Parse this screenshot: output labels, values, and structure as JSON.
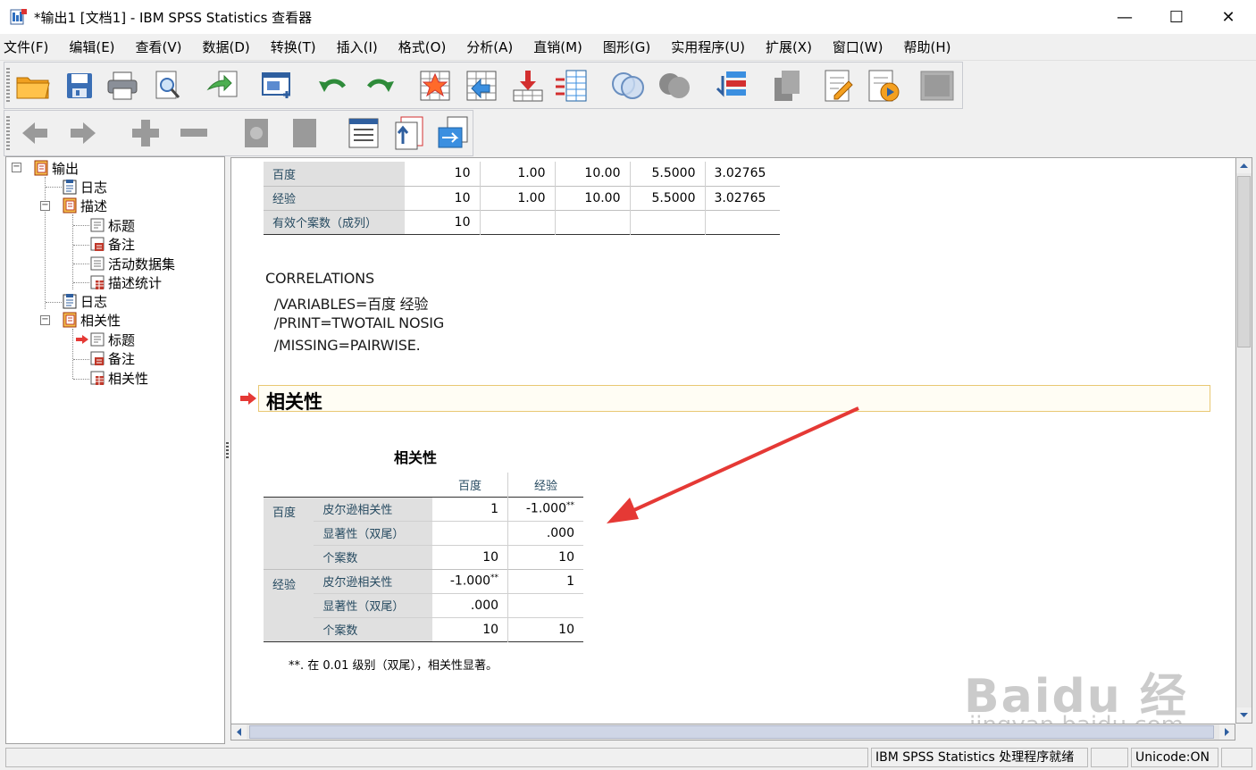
{
  "window": {
    "title": "*输出1 [文档1] - IBM SPSS Statistics 查看器",
    "minimize": "—",
    "maximize": "☐",
    "close": "✕"
  },
  "menu": [
    "文件(F)",
    "编辑(E)",
    "查看(V)",
    "数据(D)",
    "转换(T)",
    "插入(I)",
    "格式(O)",
    "分析(A)",
    "直销(M)",
    "图形(G)",
    "实用程序(U)",
    "扩展(X)",
    "窗口(W)",
    "帮助(H)"
  ],
  "toolbar1_icons": [
    "open-folder-icon",
    "save-icon",
    "print-icon",
    "print-preview-icon",
    "export-icon",
    "recall-dialog-icon",
    "undo-icon",
    "redo-icon",
    "goto-data-icon",
    "goto-case-icon",
    "goto-variable-icon",
    "variables-icon",
    "show-all-variables-icon",
    "spellcheck-icon",
    "use-variable-sets-icon",
    "designate-window-icon",
    "show-output-icon",
    "insert-text-icon",
    "run-script-icon",
    "disabled-icon"
  ],
  "toolbar2_icons": [
    "promote-icon",
    "demote-icon",
    "expand-icon",
    "collapse-icon",
    "show-icon",
    "hide-icon",
    "insert-heading-icon",
    "insert-title-icon",
    "insert-text-icon"
  ],
  "outline": {
    "items": [
      {
        "label": "输出",
        "icon": "output-book-icon"
      },
      {
        "label": "日志",
        "icon": "log-icon"
      },
      {
        "label": "描述",
        "icon": "book-icon"
      },
      {
        "label": "标题",
        "icon": "title-icon"
      },
      {
        "label": "备注",
        "icon": "notes-icon"
      },
      {
        "label": "活动数据集",
        "icon": "dataset-icon"
      },
      {
        "label": "描述统计",
        "icon": "table-icon"
      },
      {
        "label": "日志",
        "icon": "log-icon"
      },
      {
        "label": "相关性",
        "icon": "book-icon"
      },
      {
        "label": "标题",
        "icon": "title-icon"
      },
      {
        "label": "备注",
        "icon": "notes-icon"
      },
      {
        "label": "相关性",
        "icon": "table-icon"
      }
    ]
  },
  "descriptives_table": {
    "rows": [
      {
        "label": "百度",
        "n": "10",
        "min": "1.00",
        "max": "10.00",
        "mean": "5.5000",
        "sd": "3.02765"
      },
      {
        "label": "经验",
        "n": "10",
        "min": "1.00",
        "max": "10.00",
        "mean": "5.5000",
        "sd": "3.02765"
      },
      {
        "label": "有效个案数（成列）",
        "n": "10",
        "min": "",
        "max": "",
        "mean": "",
        "sd": ""
      }
    ]
  },
  "syntax": [
    "CORRELATIONS",
    "  /VARIABLES=百度 经验",
    "  /PRINT=TWOTAIL NOSIG",
    "  /MISSING=PAIRWISE."
  ],
  "heading": "相关性",
  "correlations": {
    "title": "相关性",
    "col_headers": [
      "百度",
      "经验"
    ],
    "groups": [
      {
        "var": "百度",
        "rows": [
          {
            "stat": "皮尔逊相关性",
            "v1": "1",
            "v2": "-1.000",
            "v2sup": "**",
            "v1sup": ""
          },
          {
            "stat": "显著性（双尾）",
            "v1": "",
            "v2": ".000",
            "v1sup": "",
            "v2sup": ""
          },
          {
            "stat": "个案数",
            "v1": "10",
            "v2": "10",
            "v1sup": "",
            "v2sup": ""
          }
        ]
      },
      {
        "var": "经验",
        "rows": [
          {
            "stat": "皮尔逊相关性",
            "v1": "-1.000",
            "v1sup": "**",
            "v2": "1",
            "v2sup": ""
          },
          {
            "stat": "显著性（双尾）",
            "v1": ".000",
            "v2": "",
            "v1sup": "",
            "v2sup": ""
          },
          {
            "stat": "个案数",
            "v1": "10",
            "v2": "10",
            "v1sup": "",
            "v2sup": ""
          }
        ]
      }
    ],
    "footnote": "**. 在 0.01 级别（双尾），相关性显著。"
  },
  "status": {
    "processor": "IBM SPSS Statistics 处理程序就绪",
    "unicode": "Unicode:ON"
  },
  "watermark": {
    "brand": "Baidu 经验",
    "url": "jingyan.baidu.com"
  },
  "colors": {
    "accent_arrow": "#e53935",
    "row_header_bg": "#e0e0e0",
    "heading_border": "#e9c873"
  }
}
